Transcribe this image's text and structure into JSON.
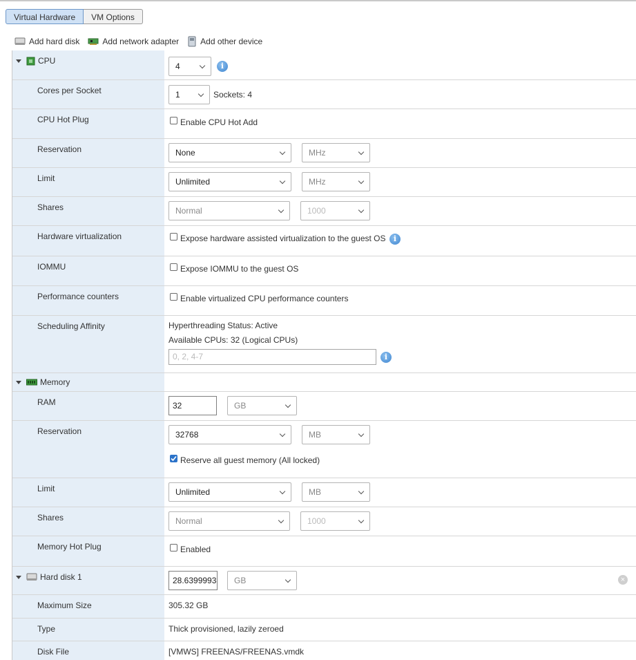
{
  "tabs": [
    {
      "label": "Virtual Hardware",
      "active": true
    },
    {
      "label": "VM Options",
      "active": false
    }
  ],
  "toolbar": {
    "add_hard_disk": "Add hard disk",
    "add_network_adapter": "Add network adapter",
    "add_other_device": "Add other device"
  },
  "cpu": {
    "label": "CPU",
    "value": "4",
    "cores_per_socket": {
      "label": "Cores per Socket",
      "value": "1",
      "sockets_text": "Sockets: 4"
    },
    "hot_plug": {
      "label": "CPU Hot Plug",
      "checkbox_label": "Enable CPU Hot Add",
      "checked": false
    },
    "reservation": {
      "label": "Reservation",
      "value": "None",
      "unit": "MHz"
    },
    "limit": {
      "label": "Limit",
      "value": "Unlimited",
      "unit": "MHz"
    },
    "shares": {
      "label": "Shares",
      "value": "Normal",
      "amount": "1000"
    },
    "hw_virt": {
      "label": "Hardware virtualization",
      "checkbox_label": "Expose hardware assisted virtualization to the guest OS",
      "checked": false
    },
    "iommu": {
      "label": "IOMMU",
      "checkbox_label": "Expose IOMMU to the guest OS",
      "checked": false
    },
    "perf": {
      "label": "Performance counters",
      "checkbox_label": "Enable virtualized CPU performance counters",
      "checked": false
    },
    "affinity": {
      "label": "Scheduling Affinity",
      "status": "Hyperthreading Status: Active",
      "available": "Available CPUs: 32 (Logical CPUs)",
      "placeholder": "0, 2, 4-7"
    }
  },
  "memory": {
    "label": "Memory",
    "ram": {
      "label": "RAM",
      "value": "32",
      "unit": "GB"
    },
    "reservation": {
      "label": "Reservation",
      "value": "32768",
      "unit": "MB",
      "checkbox_label": "Reserve all guest memory (All locked)",
      "checked": true
    },
    "limit": {
      "label": "Limit",
      "value": "Unlimited",
      "unit": "MB"
    },
    "shares": {
      "label": "Shares",
      "value": "Normal",
      "amount": "1000"
    },
    "hot_plug": {
      "label": "Memory Hot Plug",
      "checkbox_label": "Enabled",
      "checked": false
    }
  },
  "hard_disk": {
    "label": "Hard disk 1",
    "value": "28.639999389648438",
    "unit": "GB",
    "max_size": {
      "label": "Maximum Size",
      "value": "305.32 GB"
    },
    "type": {
      "label": "Type",
      "value": "Thick provisioned, lazily zeroed"
    },
    "disk_file": {
      "label": "Disk File",
      "value": "[VMWS] FREENAS/FREENAS.vmdk"
    }
  },
  "colors": {
    "accent": "#2c73c9",
    "label_column": "#e5eef7",
    "active_tab": "#cfe1f5"
  }
}
